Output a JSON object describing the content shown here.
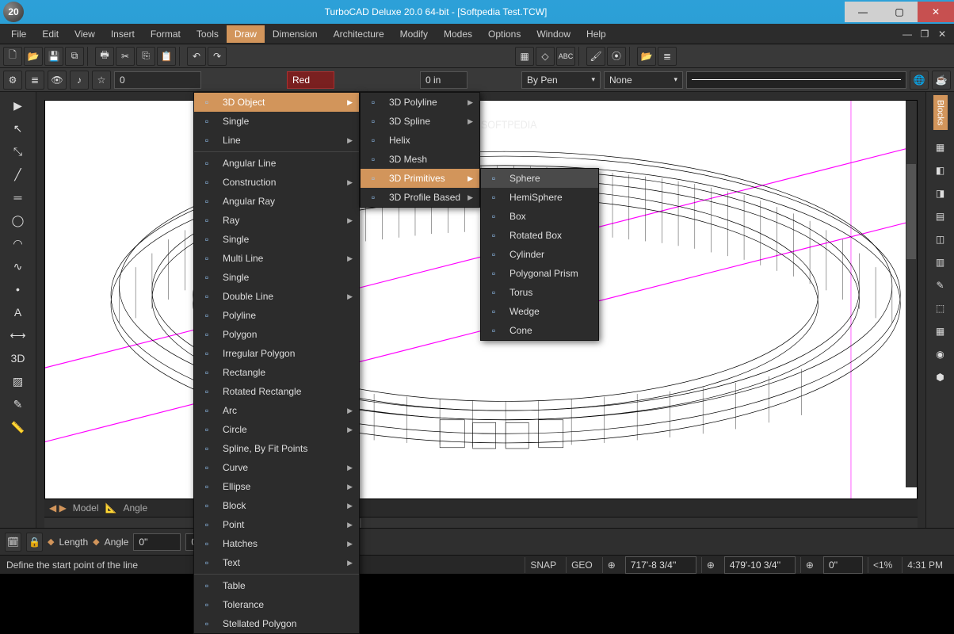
{
  "title": "TurboCAD Deluxe 20.0 64-bit - [Softpedia Test.TCW]",
  "app_badge": "20",
  "menubar": [
    "File",
    "Edit",
    "View",
    "Insert",
    "Format",
    "Tools",
    "Draw",
    "Dimension",
    "Architecture",
    "Modify",
    "Modes",
    "Options",
    "Window",
    "Help"
  ],
  "menubar_active": "Draw",
  "propbar": {
    "layer_value": "0",
    "red_label": "Red",
    "in_value": "0 in",
    "bypen": "By Pen",
    "none": "None"
  },
  "draw_menu": [
    {
      "label": "3D Object",
      "arrow": true,
      "hl": true
    },
    {
      "label": "Single"
    },
    {
      "label": "Line",
      "arrow": true
    },
    {
      "sep": true
    },
    {
      "label": "Angular Line"
    },
    {
      "label": "Construction",
      "arrow": true
    },
    {
      "label": "Angular Ray"
    },
    {
      "label": "Ray",
      "arrow": true
    },
    {
      "label": "Single"
    },
    {
      "label": "Multi Line",
      "arrow": true
    },
    {
      "label": "Single"
    },
    {
      "label": "Double Line",
      "arrow": true
    },
    {
      "label": "Polyline"
    },
    {
      "label": "Polygon"
    },
    {
      "label": "Irregular Polygon"
    },
    {
      "label": "Rectangle"
    },
    {
      "label": "Rotated Rectangle"
    },
    {
      "label": "Arc",
      "arrow": true
    },
    {
      "label": "Circle",
      "arrow": true
    },
    {
      "label": "Spline, By Fit Points"
    },
    {
      "label": "Curve",
      "arrow": true
    },
    {
      "label": "Ellipse",
      "arrow": true
    },
    {
      "label": "Block",
      "arrow": true
    },
    {
      "label": "Point",
      "arrow": true
    },
    {
      "label": "Hatches",
      "arrow": true
    },
    {
      "label": "Text",
      "arrow": true
    },
    {
      "sep": true
    },
    {
      "label": "Table"
    },
    {
      "label": "Tolerance"
    },
    {
      "label": "Stellated Polygon"
    }
  ],
  "sub1": [
    {
      "label": "3D Polyline",
      "arrow": true
    },
    {
      "label": "3D Spline",
      "arrow": true
    },
    {
      "label": "Helix"
    },
    {
      "label": "3D Mesh"
    },
    {
      "label": "3D Primitives",
      "arrow": true,
      "hl": true
    },
    {
      "label": "3D Profile Based",
      "arrow": true
    }
  ],
  "sub2": [
    {
      "label": "Sphere",
      "sel": true
    },
    {
      "label": "HemiSphere"
    },
    {
      "label": "Box"
    },
    {
      "label": "Rotated Box"
    },
    {
      "label": "Cylinder"
    },
    {
      "label": "Polygonal Prism"
    },
    {
      "label": "Torus"
    },
    {
      "label": "Wedge"
    },
    {
      "label": "Cone"
    }
  ],
  "bottombar": {
    "length_label": "Length",
    "angle_label": "Angle",
    "length_val": "0''",
    "angle_val": "0"
  },
  "status": {
    "hint": "Define the start point of the line",
    "snap": "SNAP",
    "geo": "GEO",
    "x": "717'-8 3/4''",
    "y": "479'-10 3/4''",
    "z": "0''",
    "zoom": "<1%",
    "time": "4:31 PM"
  },
  "tabs": {
    "t1": "Model",
    "t2": "Angle"
  },
  "side_tab": "Blocks"
}
